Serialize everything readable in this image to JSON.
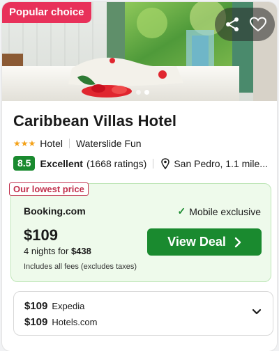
{
  "photo": {
    "badge": "Popular choice",
    "actions": {
      "share_icon": "share-icon",
      "favorite_icon": "heart-icon"
    },
    "dots": 2
  },
  "hotel": {
    "name": "Caribbean Villas Hotel",
    "stars_glyph": "★★★",
    "stars": 3,
    "type": "Hotel",
    "amenity": "Waterslide Fun",
    "score": "8.5",
    "rating_word": "Excellent",
    "ratings_count": "(1668 ratings)",
    "location": "San Pedro, 1.1 mile..."
  },
  "deal": {
    "tag": "Our lowest price",
    "provider": "Booking.com",
    "exclusive": "Mobile exclusive",
    "price": "$109",
    "nights_prefix": "4 nights for",
    "nights_total": "$438",
    "fees_note": "Includes all fees (excludes taxes)",
    "button_label": "View Deal",
    "accent": "#1a8a2f"
  },
  "other_deals": [
    {
      "price": "$109",
      "provider": "Expedia"
    },
    {
      "price": "$109",
      "provider": "Hotels.com"
    }
  ]
}
